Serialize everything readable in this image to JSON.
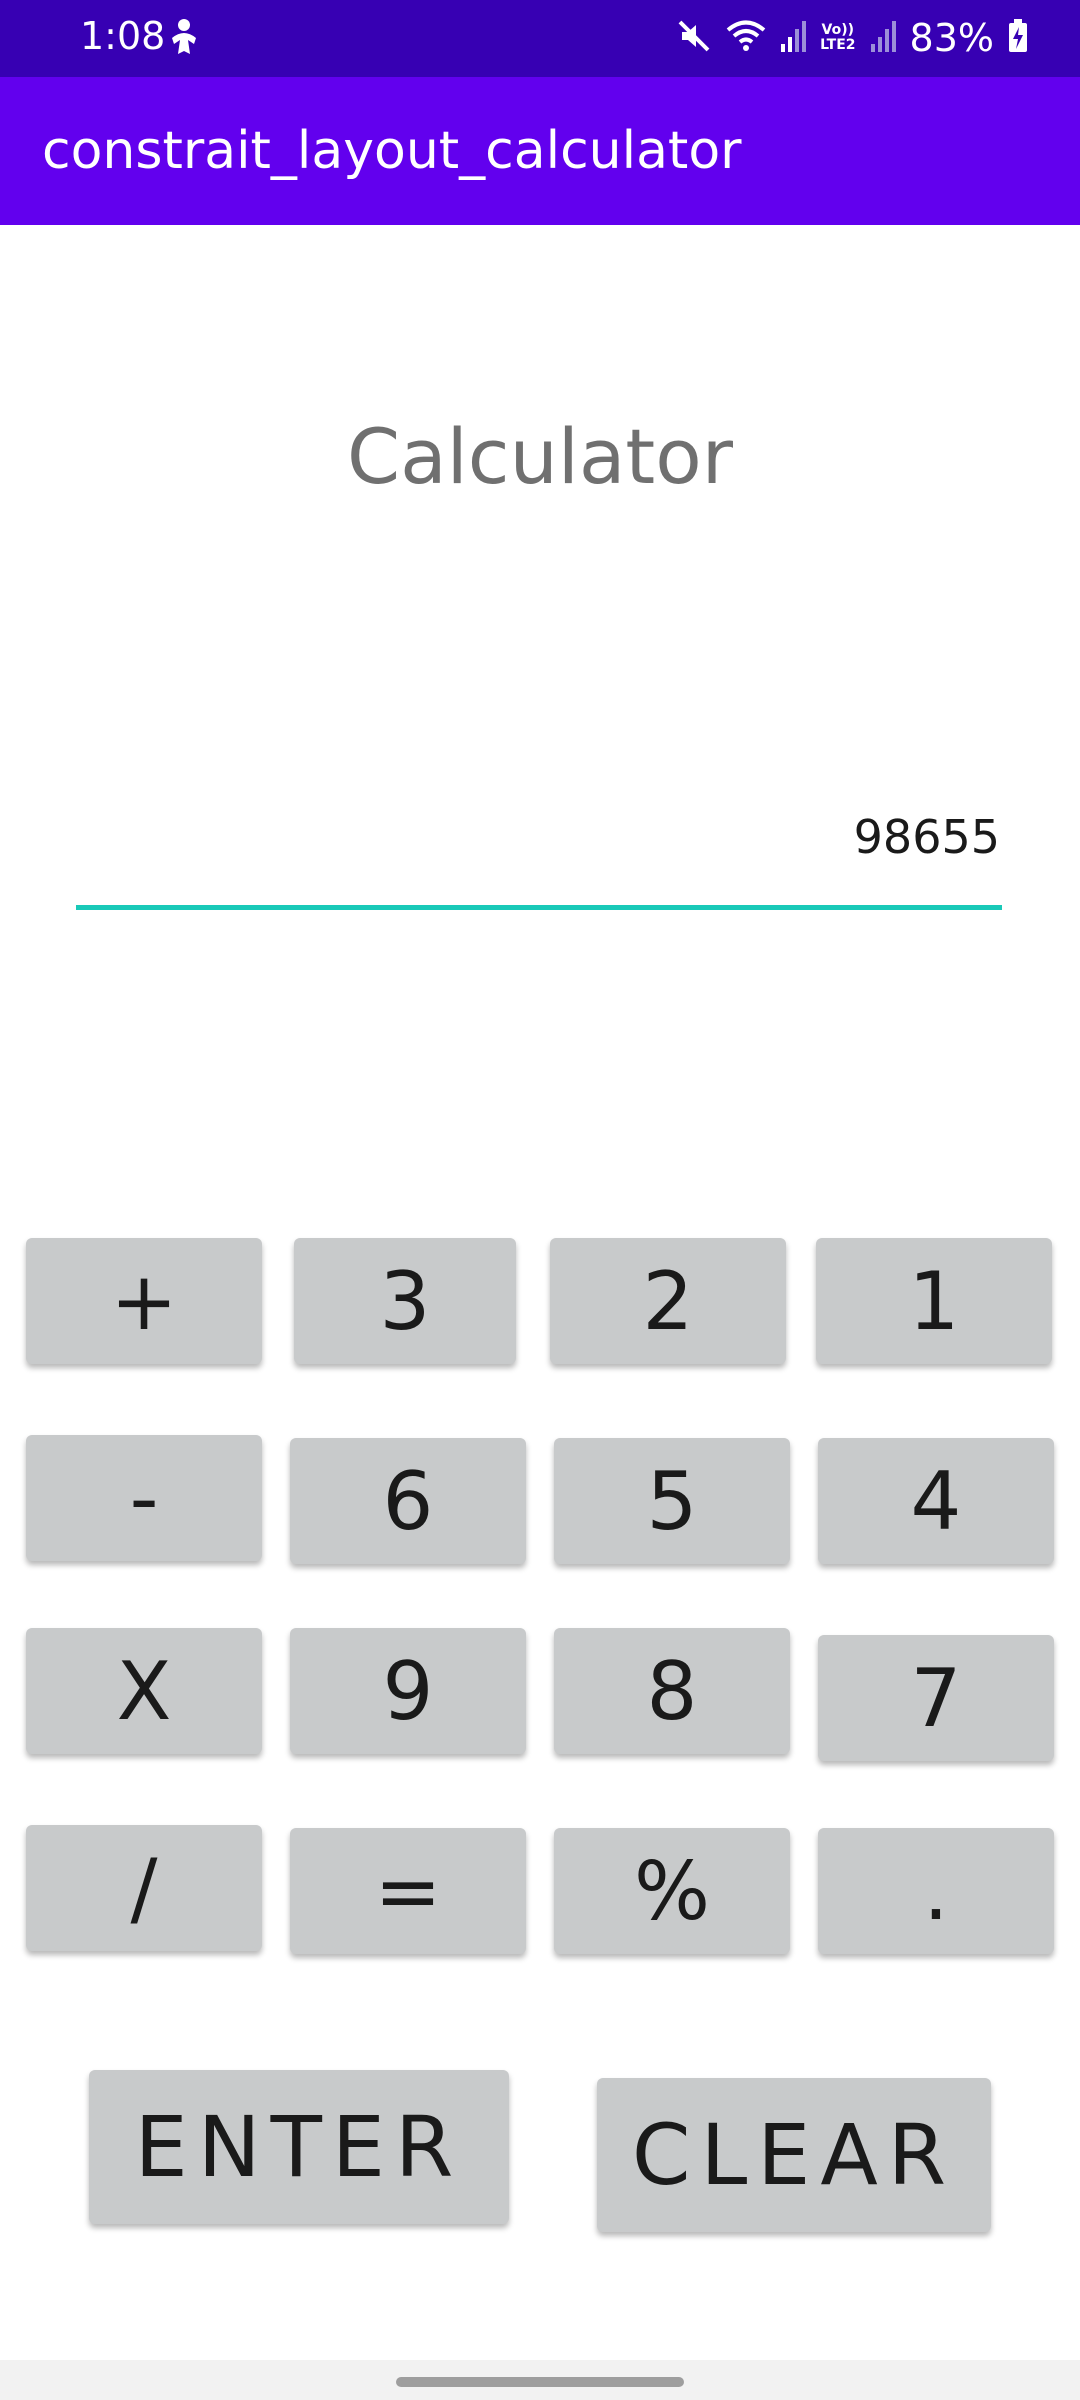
{
  "status_bar": {
    "time": "1:08",
    "network_label": "Vo))\nLTE2",
    "battery_percent": "83%",
    "icons": [
      "person-icon",
      "mute-icon",
      "wifi-icon",
      "signal-icon",
      "volte-icon",
      "signal-icon-2",
      "battery-charging-icon"
    ]
  },
  "app_bar": {
    "title": "constrait_layout_calculator"
  },
  "main": {
    "heading": "Calculator",
    "number_field_value": "98655"
  },
  "keypad": {
    "plus": "+",
    "three": "3",
    "two": "2",
    "one": "1",
    "minus": "-",
    "six": "6",
    "five": "5",
    "four": "4",
    "multiply": "X",
    "nine": "9",
    "eight": "8",
    "seven": "7",
    "divide": "/",
    "equals": "=",
    "percent": "%",
    "decimal": ".",
    "enter": "ENTER",
    "clear": "CLEAR"
  },
  "colors": {
    "status_bar": "#3700b3",
    "app_bar": "#6200ee",
    "accent_underline": "#19c9b8",
    "key_background": "#c8cacb"
  }
}
